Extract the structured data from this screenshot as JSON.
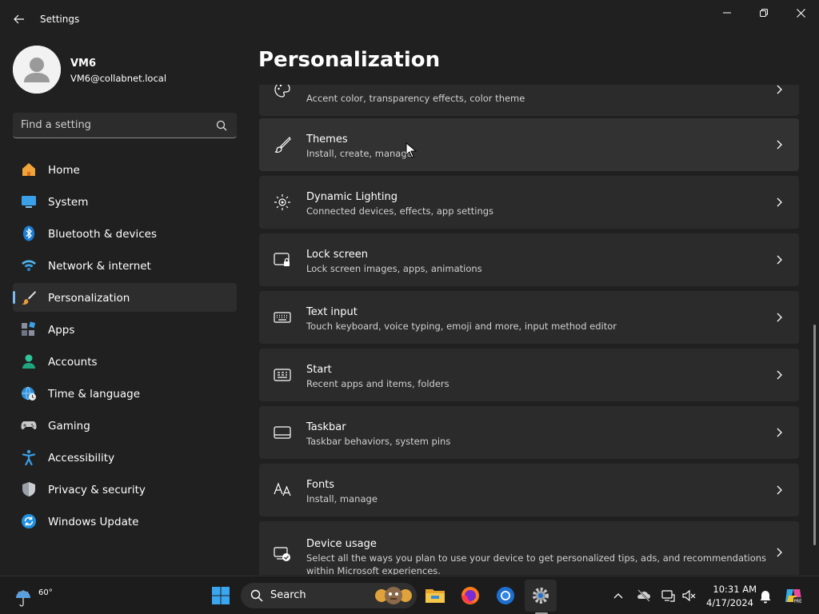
{
  "window": {
    "title": "Settings",
    "controls": {
      "minimize": "minimize",
      "maximize": "restore",
      "close": "close"
    }
  },
  "user": {
    "name": "VM6",
    "email": "VM6@collabnet.local"
  },
  "search": {
    "placeholder": "Find a setting"
  },
  "nav": {
    "items": [
      {
        "label": "Home",
        "icon": "home-icon"
      },
      {
        "label": "System",
        "icon": "system-icon"
      },
      {
        "label": "Bluetooth & devices",
        "icon": "bluetooth-icon"
      },
      {
        "label": "Network & internet",
        "icon": "wifi-icon"
      },
      {
        "label": "Personalization",
        "icon": "brush-icon",
        "active": true
      },
      {
        "label": "Apps",
        "icon": "apps-icon"
      },
      {
        "label": "Accounts",
        "icon": "account-icon"
      },
      {
        "label": "Time & language",
        "icon": "globe-clock-icon"
      },
      {
        "label": "Gaming",
        "icon": "gamepad-icon"
      },
      {
        "label": "Accessibility",
        "icon": "accessibility-icon"
      },
      {
        "label": "Privacy & security",
        "icon": "shield-icon"
      },
      {
        "label": "Windows Update",
        "icon": "update-icon"
      }
    ]
  },
  "main": {
    "title": "Personalization",
    "cards": [
      {
        "title": "",
        "subtitle": "Accent color, transparency effects, color theme",
        "icon": "palette-icon"
      },
      {
        "title": "Themes",
        "subtitle": "Install, create, manage",
        "icon": "brush-icon"
      },
      {
        "title": "Dynamic Lighting",
        "subtitle": "Connected devices, effects, app settings",
        "icon": "lighting-icon"
      },
      {
        "title": "Lock screen",
        "subtitle": "Lock screen images, apps, animations",
        "icon": "lock-screen-icon"
      },
      {
        "title": "Text input",
        "subtitle": "Touch keyboard, voice typing, emoji and more, input method editor",
        "icon": "keyboard-icon"
      },
      {
        "title": "Start",
        "subtitle": "Recent apps and items, folders",
        "icon": "start-icon"
      },
      {
        "title": "Taskbar",
        "subtitle": "Taskbar behaviors, system pins",
        "icon": "taskbar-icon"
      },
      {
        "title": "Fonts",
        "subtitle": "Install, manage",
        "icon": "fonts-icon"
      },
      {
        "title": "Device usage",
        "subtitle": "Select all the ways you plan to use your device to get personalized tips, ads, and recommendations within Microsoft experiences.",
        "icon": "device-usage-icon"
      }
    ]
  },
  "taskbar": {
    "weather_temp": "60°",
    "search_label": "Search",
    "clock_time": "10:31 AM",
    "clock_date": "4/17/2024"
  },
  "colors": {
    "accent": "#7bbcf0",
    "background": "#202020",
    "card": "#2b2b2b",
    "taskbar": "#1c1c1c"
  }
}
